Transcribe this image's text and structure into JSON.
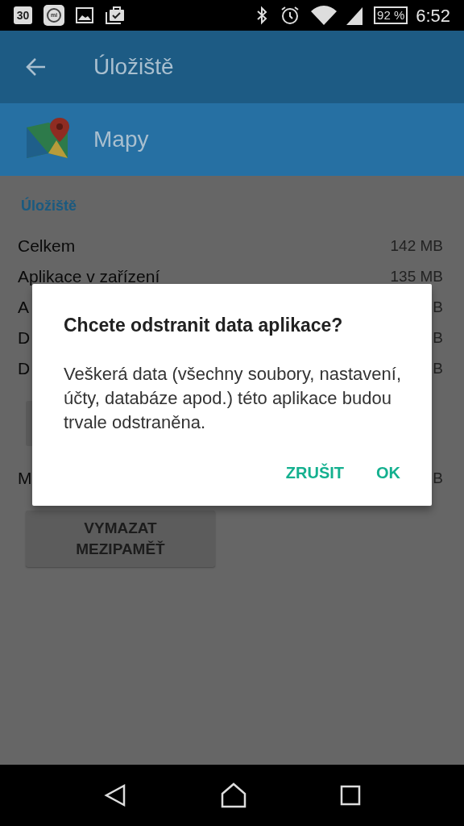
{
  "status_bar": {
    "calendar_day": "30",
    "mi_label": "mi",
    "battery": "92 %",
    "time": "6:52"
  },
  "toolbar": {
    "title": "Úložiště"
  },
  "app_header": {
    "name": "Mapy"
  },
  "content": {
    "section_title": "Úložiště",
    "items": [
      {
        "kind": "row",
        "label": "Celkem",
        "value": "142 MB"
      },
      {
        "kind": "row",
        "label": "Aplikace v zařízení",
        "value": "135 MB"
      },
      {
        "kind": "row",
        "label": "A",
        "value": "B"
      },
      {
        "kind": "row",
        "label": "D",
        "value": "B"
      },
      {
        "kind": "row",
        "label": "D",
        "value": "B"
      },
      {
        "kind": "button_edge"
      },
      {
        "kind": "row",
        "label": "M",
        "value": "B"
      },
      {
        "kind": "button",
        "label": "VYMAZAT MEZIPAMĚŤ"
      }
    ]
  },
  "dialog": {
    "title": "Chcete odstranit data aplikace?",
    "message": "Veškerá data (všechny soubory, nastavení, účty, databáze apod.) této aplikace budou trvale odstraněna.",
    "buttons": [
      "ZRUŠIT",
      "OK"
    ]
  }
}
